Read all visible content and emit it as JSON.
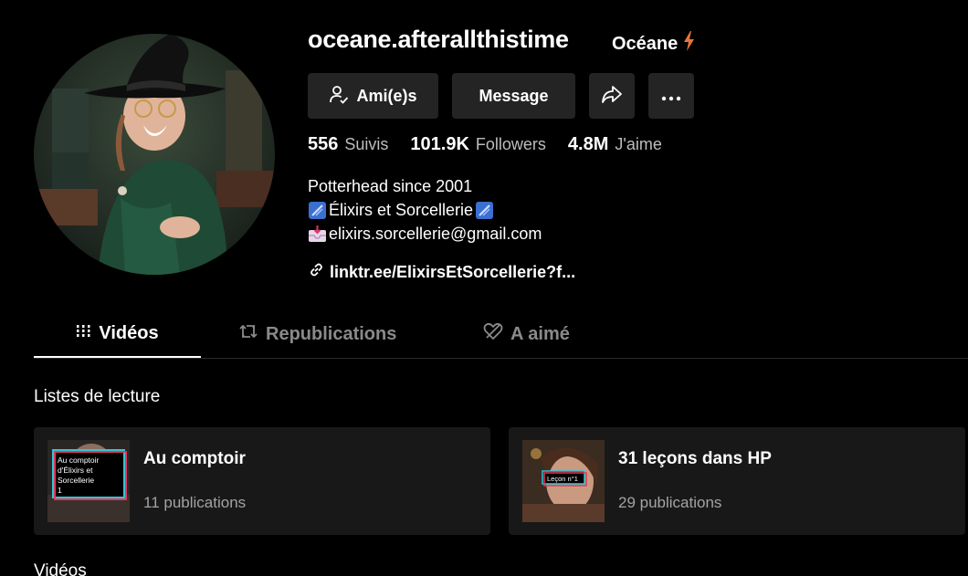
{
  "profile": {
    "username": "oceane.afterallthistime",
    "nickname": "Océane",
    "nickname_badge_icon": "lightning-icon"
  },
  "actions": {
    "friends_label": "Ami(e)s",
    "message_label": "Message",
    "share_icon": "share-icon",
    "more_icon": "more-icon"
  },
  "stats": {
    "following_count": "556",
    "following_label": "Suivis",
    "followers_count": "101.9K",
    "followers_label": "Followers",
    "likes_count": "4.8M",
    "likes_label": "J'aime"
  },
  "bio": {
    "line1": "Potterhead since 2001",
    "line2": "Élixirs et Sorcellerie",
    "line3": "elixirs.sorcellerie@gmail.com",
    "link": "linktr.ee/ElixirsEtSorcellerie?f..."
  },
  "tabs": [
    {
      "label": "Vidéos",
      "icon": "grid-icon",
      "active": true
    },
    {
      "label": "Republications",
      "icon": "repost-icon",
      "active": false
    },
    {
      "label": "A aimé",
      "icon": "heart-icon",
      "active": false
    }
  ],
  "playlists": {
    "section_title": "Listes de lecture",
    "items": [
      {
        "title": "Au comptoir",
        "count": "11 publications",
        "thumb_text": "Au comptoir d'Élixirs et Sorcellerie 1"
      },
      {
        "title": "31 leçons dans HP",
        "count": "29 publications",
        "thumb_text": "Leçon n°1"
      }
    ]
  },
  "videos_section_title": "Vidéos",
  "colors": {
    "background": "#000000",
    "button_bg": "#242424",
    "card_bg": "#181818",
    "muted_text": "#bdbdbd",
    "bolt": "#e8743b"
  }
}
